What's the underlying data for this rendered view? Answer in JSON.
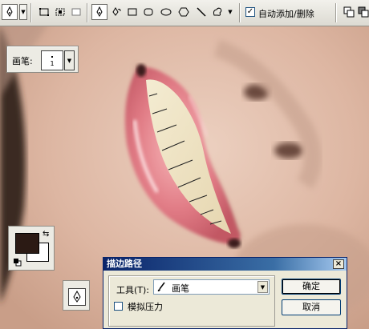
{
  "toolbar": {
    "auto_add_delete_checked": true,
    "auto_add_delete_label": "自动添加/删除",
    "check_mark": "✓"
  },
  "brush_panel": {
    "label": "画笔:",
    "size_value": "1"
  },
  "colors": {
    "foreground": "#2b1a14",
    "background": "#ffffff",
    "dialog_title_bar": "#0a246a",
    "panel": "#ecebe4"
  },
  "dialog": {
    "title": "描边路径",
    "close_label": "×",
    "tool_label": "工具(T):",
    "tool_value": "画笔",
    "simulate_pressure_label": "模拟压力",
    "simulate_pressure_checked": false,
    "ok_label": "确定",
    "cancel_label": "取消"
  },
  "icons": {
    "pen": "pen-icon",
    "freeform_pen": "freeform-pen-icon",
    "rectangle": "rectangle-shape-icon",
    "rounded_rectangle": "rounded-rectangle-icon",
    "ellipse": "ellipse-icon",
    "polygon": "polygon-icon",
    "line": "line-icon",
    "custom_shape": "custom-shape-icon"
  }
}
